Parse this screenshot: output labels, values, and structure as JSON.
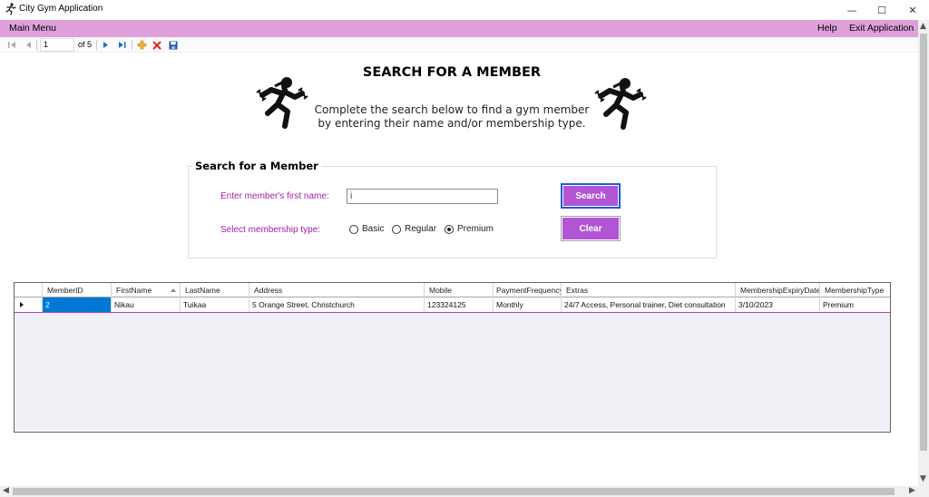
{
  "window": {
    "title": "City Gym Application",
    "controls": {
      "minimize": "—",
      "maximize": "☐",
      "close": "✕"
    }
  },
  "menu": {
    "main": "Main Menu",
    "help": "Help",
    "exit": "Exit Application"
  },
  "navigator": {
    "position": "1",
    "count": "of 5",
    "icons": [
      "move-first-icon",
      "move-previous-icon",
      "move-next-icon",
      "move-last-icon",
      "add-new-icon",
      "delete-icon",
      "save-icon"
    ]
  },
  "header": {
    "title": "SEARCH FOR A MEMBER",
    "line1": "Complete the search below to find a gym member",
    "line2": "by entering their name and/or membership type."
  },
  "search": {
    "group_title": "Search for a Member",
    "name_label": "Enter member's first name:",
    "name_value": "i",
    "type_label": "Select membership type:",
    "types": [
      {
        "label": "Basic",
        "selected": false
      },
      {
        "label": "Regular",
        "selected": false
      },
      {
        "label": "Premium",
        "selected": true
      }
    ],
    "search_button": "Search",
    "clear_button": "Clear"
  },
  "grid": {
    "columns": [
      "MemberID",
      "FirstName",
      "LastName",
      "Address",
      "Mobile",
      "PaymentFrequency",
      "Extras",
      "MembershipExpiryDate",
      "MembershipType"
    ],
    "sorted_column": "FirstName",
    "rows": [
      [
        "2",
        "Nikau",
        "Tuikaa",
        "5 Orange Street, Christchurch",
        "123324125",
        "Monthly",
        "24/7 Access, Personal trainer, Diet consultation",
        "3/10/2023",
        "Premium"
      ]
    ]
  },
  "colors": {
    "menu_bar": "#dfa0dc",
    "button": "#b155d4",
    "label_text": "#a01fa8",
    "selection": "#0078d7"
  }
}
